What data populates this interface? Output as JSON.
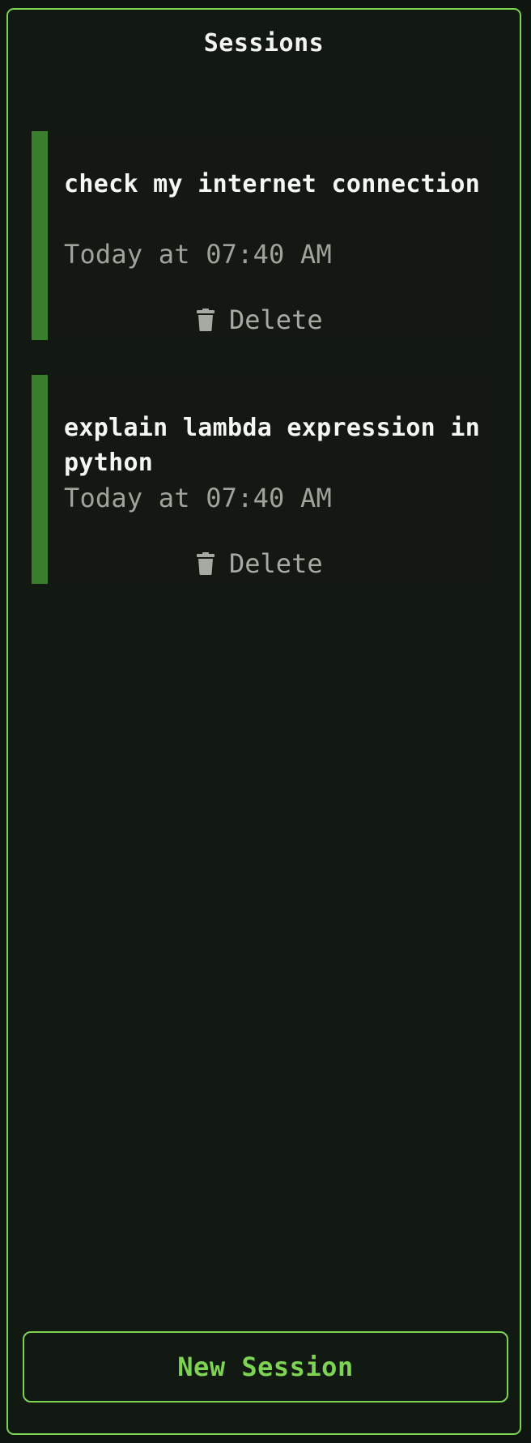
{
  "panel": {
    "title": "Sessions",
    "accent_color": "#7dd352",
    "card_accent_color": "#3a7f2c"
  },
  "sessions": [
    {
      "title": "check my internet connection",
      "time": "Today at 07:40 AM",
      "delete_label": "Delete",
      "delete_icon": "trash-icon"
    },
    {
      "title": "explain lambda expression in python",
      "time": "Today at 07:40 AM",
      "delete_label": "Delete",
      "delete_icon": "trash-icon"
    }
  ],
  "new_session_button": {
    "label": "New Session"
  }
}
